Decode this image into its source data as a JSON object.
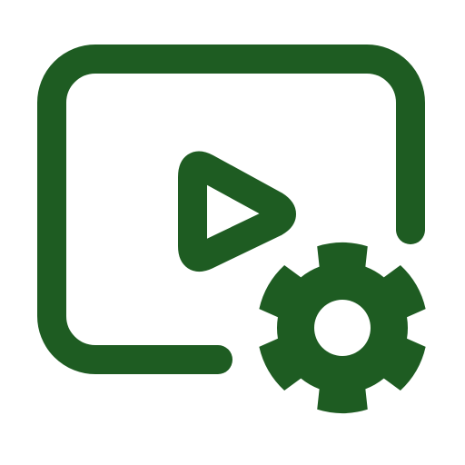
{
  "icon": {
    "name": "video-settings",
    "description_icon": "video-settings-icon",
    "color": "#1e5c22",
    "background": "#ffffff"
  }
}
